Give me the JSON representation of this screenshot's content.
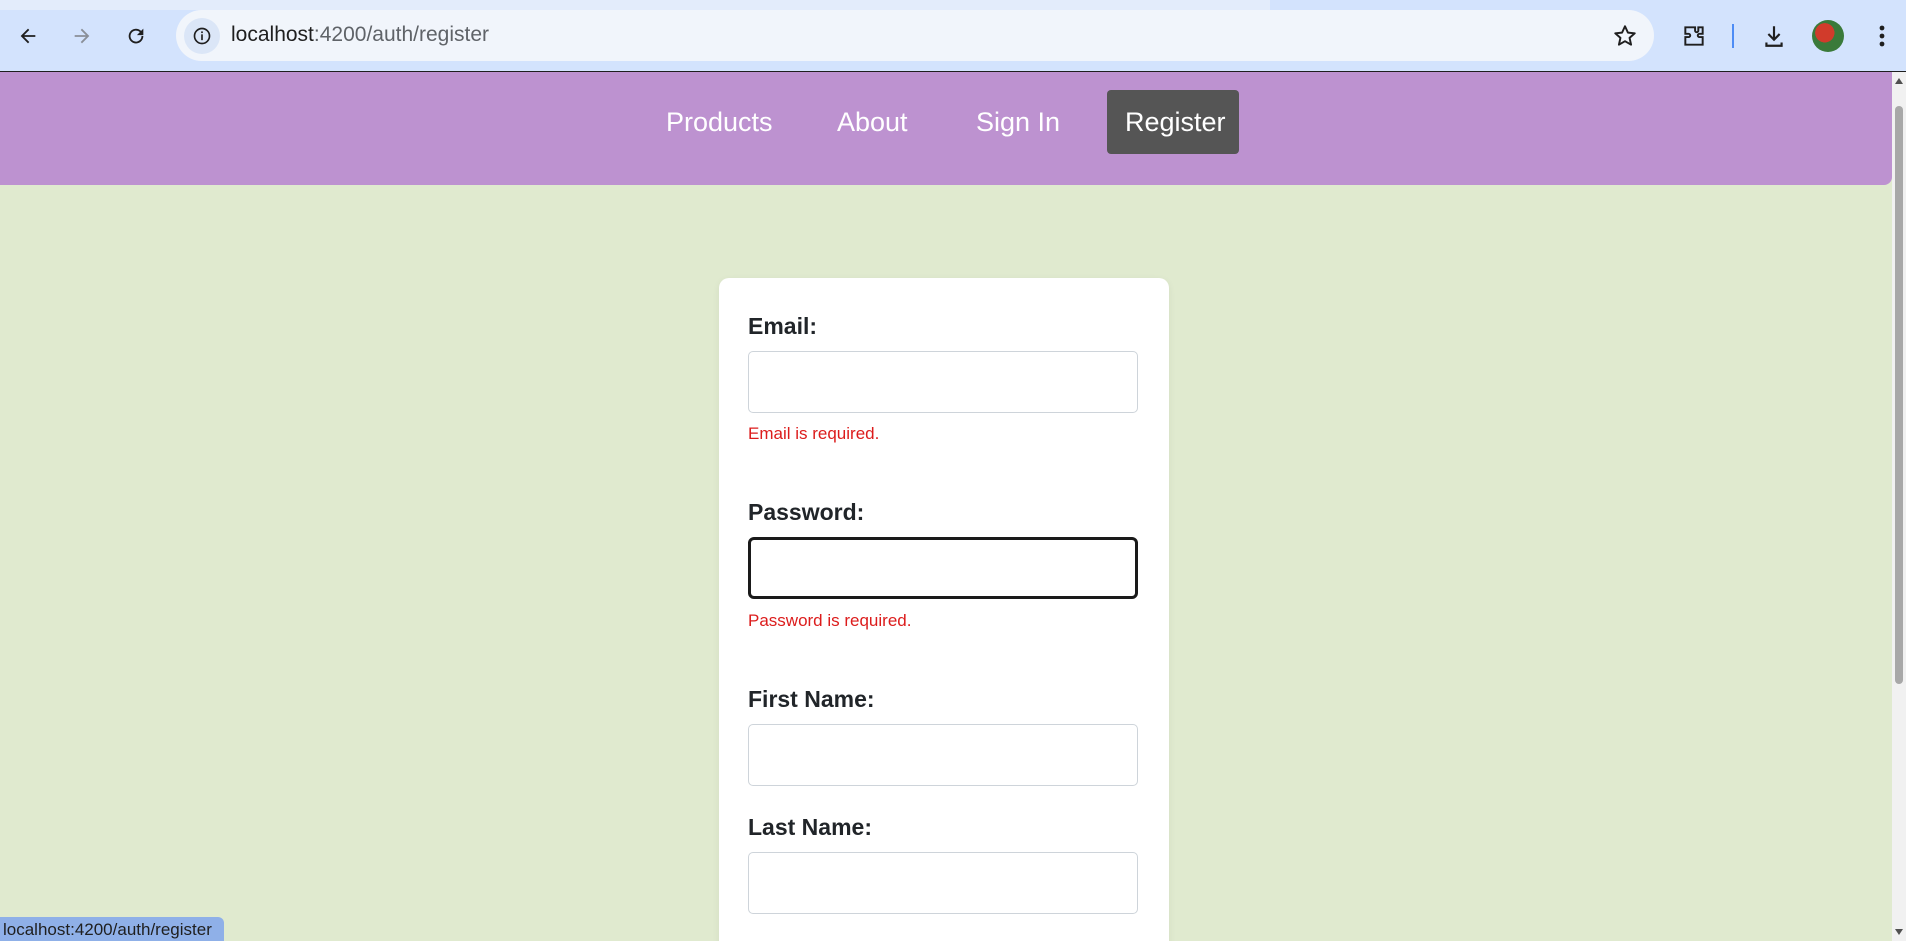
{
  "browser": {
    "url_host": "localhost",
    "url_rest": ":4200/auth/register",
    "status_text": "localhost:4200/auth/register",
    "icons": [
      "back-arrow-icon",
      "forward-arrow-icon",
      "reload-icon",
      "site-info-icon",
      "bookmark-star-icon",
      "extensions-icon",
      "download-icon",
      "profile-avatar",
      "more-menu-icon"
    ]
  },
  "nav": {
    "items": [
      {
        "label": "Products"
      },
      {
        "label": "About"
      },
      {
        "label": "Sign In"
      },
      {
        "label": "Register",
        "active": true
      }
    ]
  },
  "form": {
    "email": {
      "label": "Email:",
      "value": "",
      "error": "Email is required."
    },
    "password": {
      "label": "Password:",
      "value": "",
      "error": "Password is required."
    },
    "first_name": {
      "label": "First Name:",
      "value": ""
    },
    "last_name": {
      "label": "Last Name:",
      "value": ""
    }
  },
  "colors": {
    "nav_bg": "#bd92d0",
    "page_bg": "#e0eacf",
    "active_nav_bg": "#555555",
    "error": "#dc1c1c"
  }
}
